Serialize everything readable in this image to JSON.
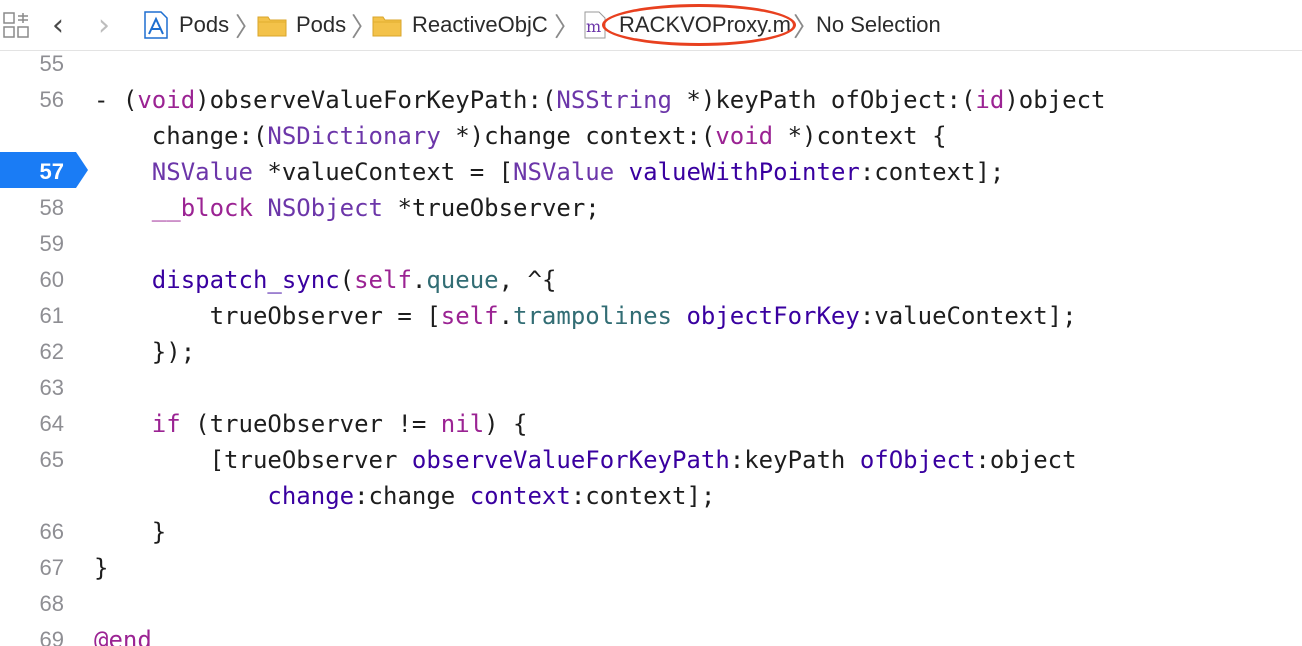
{
  "colors": {
    "keyword": "#9b2393",
    "type": "#6c36a9",
    "method": "#3900a0",
    "property": "#326d74",
    "plain": "#1d1d1d",
    "line_number": "#8e8e93",
    "current_line_marker": "#1a7cf5",
    "annotation_circle": "#e8401f"
  },
  "jump_bar": {
    "grid_icon": "related-items-grid-icon",
    "back_icon": "chevron-left-icon",
    "forward_icon": "chevron-right-icon",
    "breadcrumbs": [
      {
        "icon": "xcodeproj-icon",
        "label": "Pods"
      },
      {
        "icon": "folder-icon",
        "label": "Pods"
      },
      {
        "icon": "folder-icon",
        "label": "ReactiveObjC"
      },
      {
        "icon": "objc-file-icon",
        "icon_letter": "m",
        "label": "RACKVOProxy.m"
      },
      {
        "label": "No Selection"
      }
    ]
  },
  "editor": {
    "current_line": "57",
    "rows": [
      {
        "number": "55",
        "tokens": []
      },
      {
        "number": "56",
        "tokens": [
          {
            "t": "- (",
            "c": "plain"
          },
          {
            "t": "void",
            "c": "kw"
          },
          {
            "t": ")observeValueForKeyPath:(",
            "c": "plain"
          },
          {
            "t": "NSString",
            "c": "type"
          },
          {
            "t": " *)keyPath ofObject:(",
            "c": "plain"
          },
          {
            "t": "id",
            "c": "kw"
          },
          {
            "t": ")object",
            "c": "plain"
          }
        ]
      },
      {
        "number": "",
        "tokens": [
          {
            "t": "    change:(",
            "c": "plain"
          },
          {
            "t": "NSDictionary",
            "c": "type"
          },
          {
            "t": " *)change context:(",
            "c": "plain"
          },
          {
            "t": "void",
            "c": "kw"
          },
          {
            "t": " *)context {",
            "c": "plain"
          }
        ]
      },
      {
        "number": "57",
        "tokens": [
          {
            "t": "    ",
            "c": "plain"
          },
          {
            "t": "NSValue",
            "c": "type"
          },
          {
            "t": " *valueContext = [",
            "c": "plain"
          },
          {
            "t": "NSValue",
            "c": "type"
          },
          {
            "t": " ",
            "c": "plain"
          },
          {
            "t": "valueWithPointer",
            "c": "method"
          },
          {
            "t": ":context];",
            "c": "plain"
          }
        ]
      },
      {
        "number": "58",
        "tokens": [
          {
            "t": "    ",
            "c": "plain"
          },
          {
            "t": "__block",
            "c": "kw"
          },
          {
            "t": " ",
            "c": "plain"
          },
          {
            "t": "NSObject",
            "c": "type"
          },
          {
            "t": " *trueObserver;",
            "c": "plain"
          }
        ]
      },
      {
        "number": "59",
        "tokens": []
      },
      {
        "number": "60",
        "tokens": [
          {
            "t": "    ",
            "c": "plain"
          },
          {
            "t": "dispatch_sync",
            "c": "method"
          },
          {
            "t": "(",
            "c": "plain"
          },
          {
            "t": "self",
            "c": "kw"
          },
          {
            "t": ".",
            "c": "plain"
          },
          {
            "t": "queue",
            "c": "prop"
          },
          {
            "t": ", ^{",
            "c": "plain"
          }
        ]
      },
      {
        "number": "61",
        "tokens": [
          {
            "t": "        trueObserver = [",
            "c": "plain"
          },
          {
            "t": "self",
            "c": "kw"
          },
          {
            "t": ".",
            "c": "plain"
          },
          {
            "t": "trampolines",
            "c": "prop"
          },
          {
            "t": " ",
            "c": "plain"
          },
          {
            "t": "objectForKey",
            "c": "method"
          },
          {
            "t": ":valueContext];",
            "c": "plain"
          }
        ]
      },
      {
        "number": "62",
        "tokens": [
          {
            "t": "    });",
            "c": "plain"
          }
        ]
      },
      {
        "number": "63",
        "tokens": []
      },
      {
        "number": "64",
        "tokens": [
          {
            "t": "    ",
            "c": "plain"
          },
          {
            "t": "if",
            "c": "kw"
          },
          {
            "t": " (trueObserver != ",
            "c": "plain"
          },
          {
            "t": "nil",
            "c": "kw"
          },
          {
            "t": ") {",
            "c": "plain"
          }
        ]
      },
      {
        "number": "65",
        "tokens": [
          {
            "t": "        [trueObserver ",
            "c": "plain"
          },
          {
            "t": "observeValueForKeyPath",
            "c": "method"
          },
          {
            "t": ":keyPath ",
            "c": "plain"
          },
          {
            "t": "ofObject",
            "c": "method"
          },
          {
            "t": ":object",
            "c": "plain"
          }
        ]
      },
      {
        "number": "",
        "tokens": [
          {
            "t": "            ",
            "c": "plain"
          },
          {
            "t": "change",
            "c": "method"
          },
          {
            "t": ":change ",
            "c": "plain"
          },
          {
            "t": "context",
            "c": "method"
          },
          {
            "t": ":context];",
            "c": "plain"
          }
        ]
      },
      {
        "number": "66",
        "tokens": [
          {
            "t": "    }",
            "c": "plain"
          }
        ]
      },
      {
        "number": "67",
        "tokens": [
          {
            "t": "}",
            "c": "plain"
          }
        ]
      },
      {
        "number": "68",
        "tokens": []
      },
      {
        "number": "69",
        "tokens": [
          {
            "t": "@end",
            "c": "kw"
          }
        ]
      }
    ]
  }
}
